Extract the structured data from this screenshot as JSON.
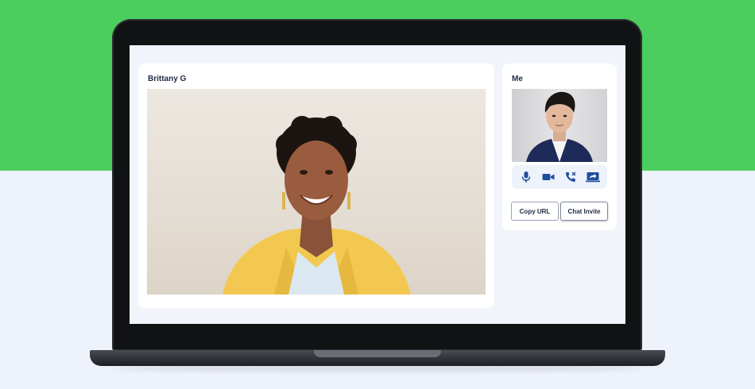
{
  "remote": {
    "name": "Brittany G"
  },
  "self": {
    "label": "Me"
  },
  "controls": [
    {
      "icon": "microphone-icon"
    },
    {
      "icon": "video-camera-icon"
    },
    {
      "icon": "end-call-icon"
    },
    {
      "icon": "screen-share-icon"
    }
  ],
  "actions": {
    "copy_url": "Copy URL",
    "chat_invite": "Chat Invite"
  },
  "colors": {
    "background_green": "#4bce5e",
    "background_light": "#eef2fb",
    "icon_blue": "#1f4e9c",
    "text_dark": "#1f2a44"
  }
}
